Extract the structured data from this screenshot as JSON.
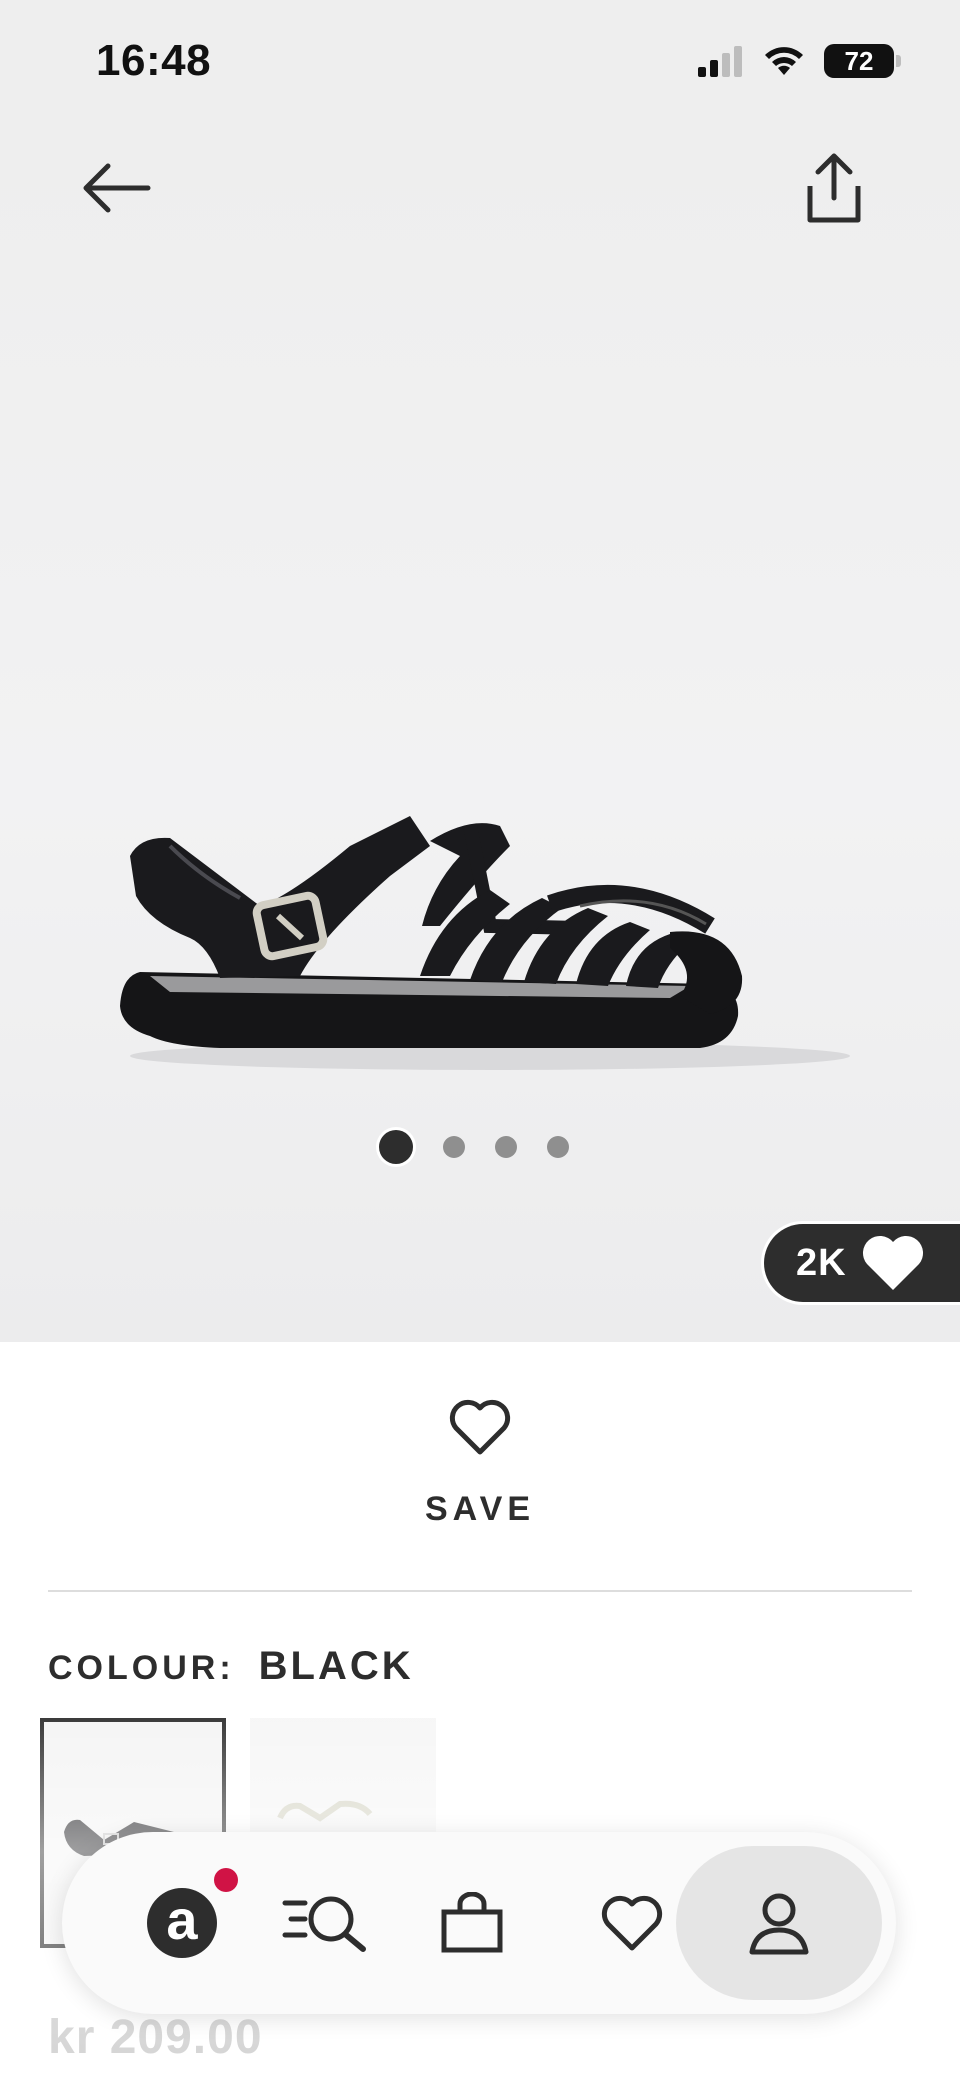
{
  "status_bar": {
    "time": "16:48",
    "battery": "72"
  },
  "gallery": {
    "image_count": 4,
    "active_index": 0,
    "saves_count": "2K"
  },
  "product": {
    "save_label": "SAVE",
    "colour_label": "COLOUR:",
    "colour_value": "BLACK",
    "price": "kr 209.00"
  },
  "icons": {
    "back": "arrow-left-icon",
    "share": "share-icon",
    "heart": "heart-icon",
    "home": "asos-logo-icon",
    "search": "search-icon",
    "bag": "bag-icon",
    "saved": "heart-icon",
    "account": "user-icon"
  },
  "colors": {
    "accent_dark": "#2d2d2d",
    "notification": "#d01345"
  }
}
